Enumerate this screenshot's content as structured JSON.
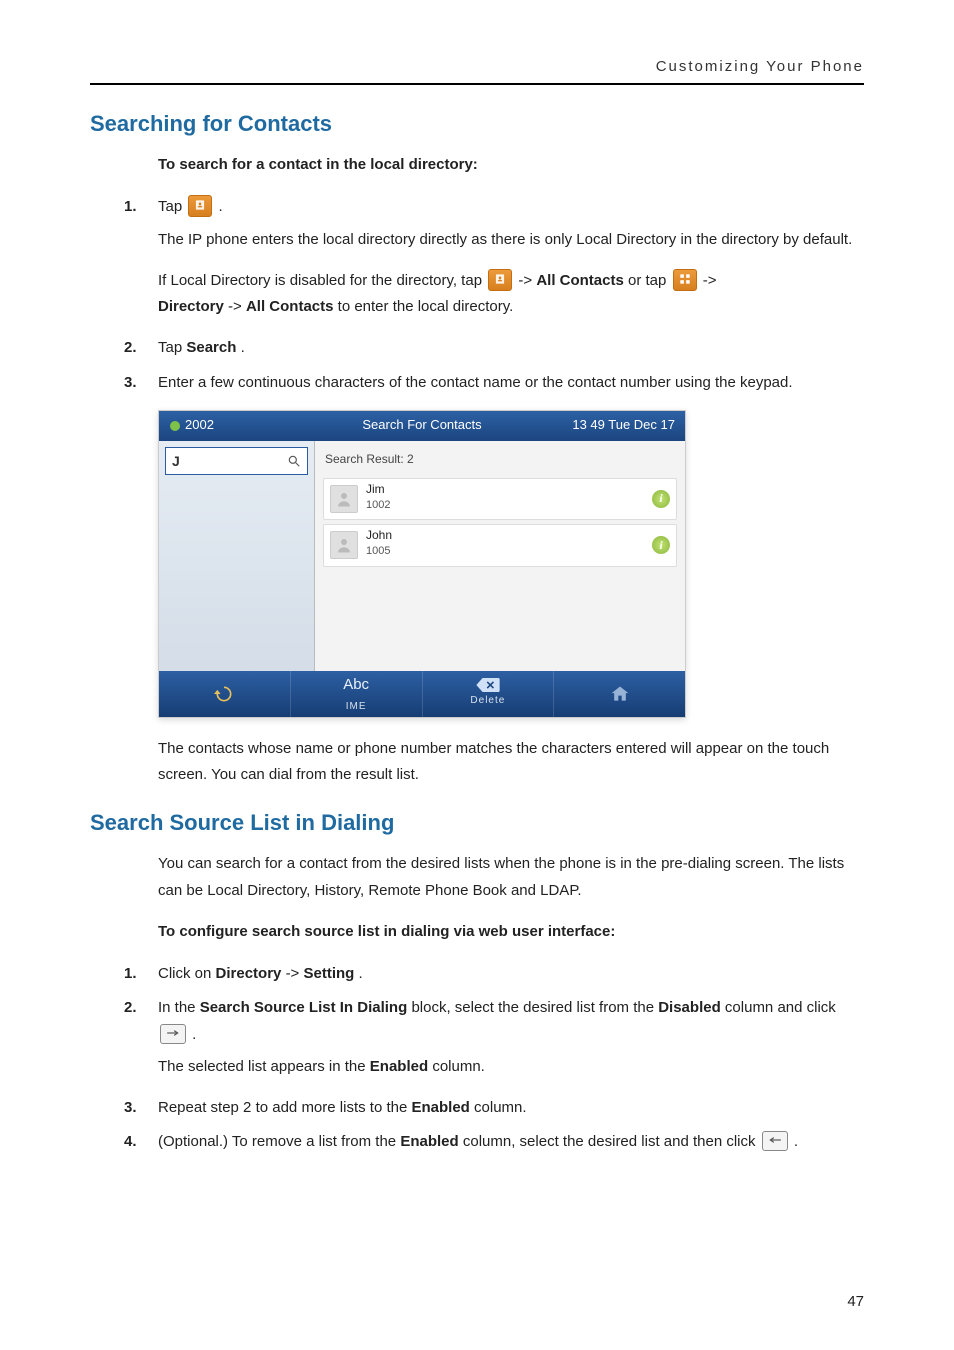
{
  "running_head": "Customizing Your Phone",
  "section1": {
    "title": "Searching for Contacts",
    "lead_bold": "To search for a contact in the local directory:",
    "steps": {
      "s1_tap": "Tap ",
      "s1_dot": " .",
      "s1_p1": "The IP phone enters the local directory directly as there is only Local Directory in the directory by default.",
      "s1_p2a": "If Local Directory is disabled for the directory, tap ",
      "s1_p2b": " ->",
      "s1_p2c": "All Contacts",
      "s1_p2d": " or tap ",
      "s1_p2e": " -> ",
      "s1_p2f": "Directory",
      "s1_p2g": " ->",
      "s1_p2h": "All Contacts",
      "s1_p2i": " to enter the local directory.",
      "s2a": "Tap ",
      "s2b": "Search",
      "s2c": ".",
      "s3": "Enter a few continuous characters of the contact name or the contact number using the keypad."
    },
    "screenshot": {
      "account": "2002",
      "title": "Search For Contacts",
      "time": "13 49 Tue Dec 17",
      "query": "J",
      "result_label": "Search Result: 2",
      "results": [
        {
          "name": "Jim",
          "number": "1002"
        },
        {
          "name": "John",
          "number": "1005"
        }
      ],
      "bottom": {
        "ime_big": "Abc",
        "ime_small": "IME",
        "delete": "Delete"
      }
    },
    "after_shot": "The contacts whose name or phone number matches the characters entered will appear on the touch screen. You can dial from the result list."
  },
  "section2": {
    "title": "Search Source List in Dialing",
    "intro": "You can search for a contact from the desired lists when the phone is in the pre-dialing screen. The lists can be Local Directory, History, Remote Phone Book and LDAP.",
    "lead_bold": "To configure search source list in dialing via web user interface:",
    "steps": {
      "s1a": "Click on ",
      "s1b": "Directory",
      "s1c": "->",
      "s1d": "Setting",
      "s1e": ".",
      "s2a": "In the ",
      "s2b": "Search Source List In Dialing",
      "s2c": " block, select the desired list from the ",
      "s2d": "Disabled",
      "s2e": " column and click ",
      "s2f": " .",
      "s2g_a": "The selected list appears in the ",
      "s2g_b": "Enabled",
      "s2g_c": " column.",
      "s3a": "Repeat step 2 to add more lists to the ",
      "s3b": "Enabled",
      "s3c": " column.",
      "s4a": "(Optional.) To remove a list from the ",
      "s4b": "Enabled",
      "s4c": " column, select the desired list and then click ",
      "s4d": " ."
    }
  },
  "page_number": "47"
}
